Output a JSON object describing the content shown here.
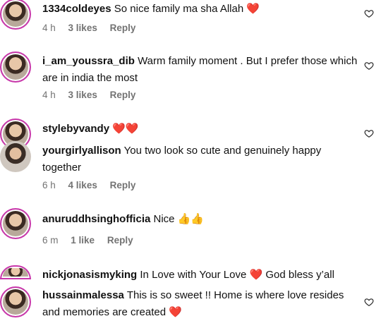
{
  "comments": [
    {
      "username": "1334coldeyes",
      "text": "So nice family ma sha Allah",
      "emoji": "❤️",
      "time": "4 h",
      "likes": "3 likes",
      "reply": "Reply"
    },
    {
      "username": "i_am_youssra_dib",
      "text": "Warm family moment . But I prefer those which are in india the most",
      "emoji": "",
      "time": "4 h",
      "likes": "3 likes",
      "reply": "Reply"
    },
    {
      "username": "stylebyvandy",
      "text": "",
      "emoji": "❤️❤️",
      "time": "",
      "likes": "",
      "reply": ""
    },
    {
      "username": "yourgirlyallison",
      "text": "You two look so cute and genuinely happy together",
      "emoji": "",
      "time": "6 h",
      "likes": "4 likes",
      "reply": "Reply"
    },
    {
      "username": "anuruddhsinghofficia",
      "text": "Nice",
      "emoji": "👍👍",
      "time": "6 m",
      "likes": "1 like",
      "reply": "Reply"
    },
    {
      "username": "nickjonasismyking",
      "text": "In Love with Your Love",
      "emoji": "❤️",
      "text2": "God bless y’all",
      "time": "",
      "likes": "",
      "reply": ""
    },
    {
      "username": "hussainmalessa",
      "text": "This is so sweet !! Home is where love resides and memories are created",
      "emoji": "❤️",
      "time": "",
      "likes": "",
      "reply": ""
    }
  ],
  "icons": {
    "like": "heart-outline-icon",
    "avatar": "user-avatar"
  },
  "colors": {
    "story_ring": "#c837ab",
    "meta_text": "#737373",
    "heart_emoji": "#e0245e"
  }
}
